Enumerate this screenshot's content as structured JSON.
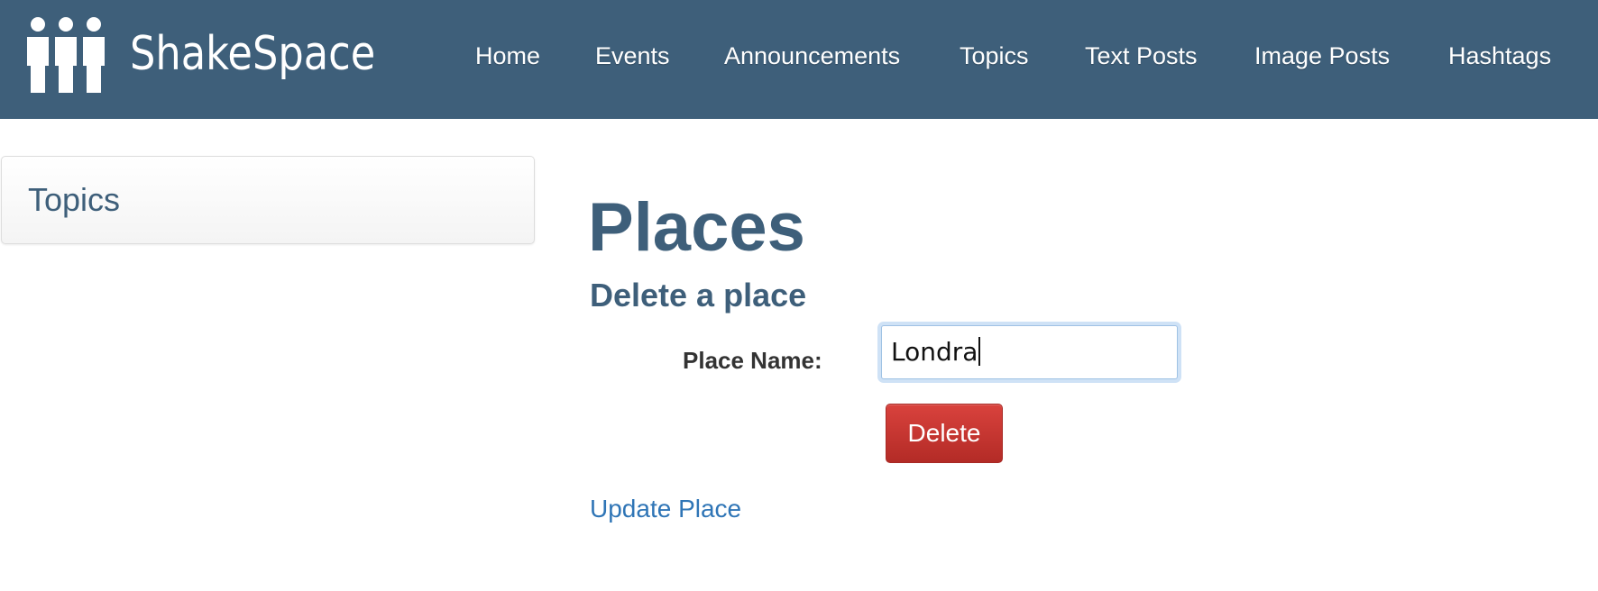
{
  "app": {
    "brand_name": "ShakeSpace"
  },
  "nav": {
    "items": [
      {
        "label": "Home"
      },
      {
        "label": "Events"
      },
      {
        "label": "Announcements"
      },
      {
        "label": "Topics"
      },
      {
        "label": "Text Posts"
      },
      {
        "label": "Image Posts"
      },
      {
        "label": "Hashtags"
      }
    ]
  },
  "sidebar": {
    "title": "Topics"
  },
  "main": {
    "page_title": "Places",
    "section_title": "Delete a place",
    "form": {
      "place_name_label": "Place Name:",
      "place_name_value": "Londra",
      "delete_label": "Delete"
    },
    "update_link": "Update Place"
  },
  "colors": {
    "navbar": "#3e5f7a",
    "heading": "#3e5f7a",
    "danger": "#c9302c",
    "link": "#2f75b6"
  },
  "icons": {
    "logo": "people-group-icon"
  }
}
